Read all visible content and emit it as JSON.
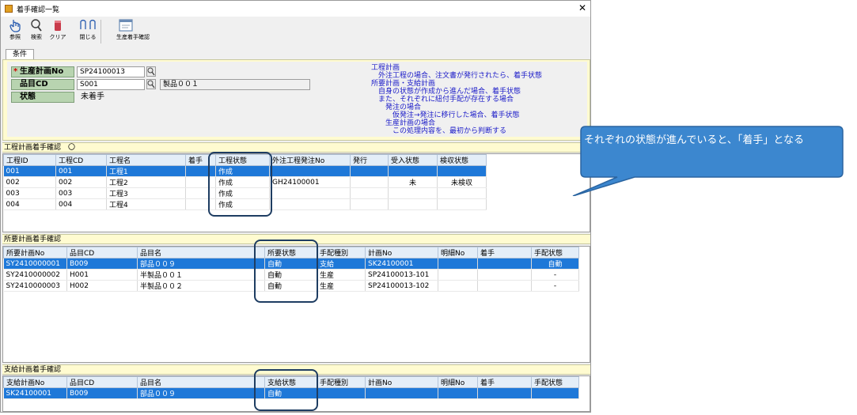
{
  "window": {
    "title": "着手確認一覧",
    "close_glyph": "✕"
  },
  "toolbar": [
    {
      "id": "ref",
      "label": "参照",
      "icon": "hand-icon"
    },
    {
      "id": "search",
      "label": "検索",
      "icon": "magnifier-icon"
    },
    {
      "id": "clear",
      "label": "クリア",
      "icon": "eraser-icon"
    },
    {
      "id": "close",
      "label": "閉じる",
      "icon": "door-icon"
    },
    {
      "id": "prod",
      "label": "生産着手確認",
      "icon": "window-icon"
    }
  ],
  "tab": {
    "label": "条件"
  },
  "conditions": {
    "plan_no": {
      "label": "生産計画No",
      "required_mark": "*",
      "value": "SP24100013"
    },
    "item_cd": {
      "label": "品目CD",
      "value": "S001",
      "name": "製品００１"
    },
    "status": {
      "label": "状態",
      "value": "未着手"
    }
  },
  "note_lines": [
    "工程計画",
    "　外注工程の場合、注文書が発行されたら、着手状態",
    "所要計画・支給計画",
    "　自身の状態が作成から進んだ場合、着手状態",
    "　また、それぞれに紐付手配が存在する場合",
    "　　発注の場合",
    "　　　仮発注→発注に移行した場合、着手状態",
    "　　生産計画の場合",
    "　　　この処理内容を、最初から判断する"
  ],
  "process_section": {
    "title": "工程計画着手確認　〇",
    "columns": [
      "工程ID",
      "工程CD",
      "工程名",
      "着手",
      "工程状態",
      "外注工程発注No",
      "発行",
      "受入状態",
      "検収状態"
    ],
    "rows": [
      [
        "001",
        "001",
        "工程1",
        "",
        "作成",
        "",
        "",
        "",
        ""
      ],
      [
        "002",
        "002",
        "工程2",
        "",
        "作成",
        "GH24100001",
        "",
        "未",
        "未検収"
      ],
      [
        "003",
        "003",
        "工程3",
        "",
        "作成",
        "",
        "",
        "",
        ""
      ],
      [
        "004",
        "004",
        "工程4",
        "",
        "作成",
        "",
        "",
        "",
        ""
      ]
    ]
  },
  "requirement_section": {
    "title": "所要計画着手確認",
    "columns": [
      "所要計画No",
      "品目CD",
      "品目名",
      "所要状態",
      "手配種別",
      "計画No",
      "明細No",
      "着手",
      "手配状態"
    ],
    "rows": [
      [
        "SY2410000001",
        "B009",
        "部品００９",
        "自動",
        "支給",
        "SK24100001",
        "",
        "",
        "自動"
      ],
      [
        "SY2410000002",
        "H001",
        "半製品００１",
        "自動",
        "生産",
        "SP24100013-101",
        "",
        "",
        "-"
      ],
      [
        "SY2410000003",
        "H002",
        "半製品００２",
        "自動",
        "生産",
        "SP24100013-102",
        "",
        "",
        "-"
      ]
    ]
  },
  "supply_section": {
    "title": "支給計画着手確認",
    "columns": [
      "支給計画No",
      "品目CD",
      "品目名",
      "支給状態",
      "手配種別",
      "計画No",
      "明細No",
      "着手",
      "手配状態"
    ],
    "rows": [
      [
        "SK24100001",
        "B009",
        "部品００９",
        "自動",
        "",
        "",
        "",
        "",
        ""
      ]
    ]
  },
  "callout": {
    "text": "それぞれの状態が進んでいると、「着手」となる"
  },
  "colors": {
    "selection": "#1e78d8",
    "condition_bg": "#fffbd0",
    "label_bg": "#b8d4b0",
    "note_text": "#1a1ac8",
    "callout": "#3c87cf"
  }
}
